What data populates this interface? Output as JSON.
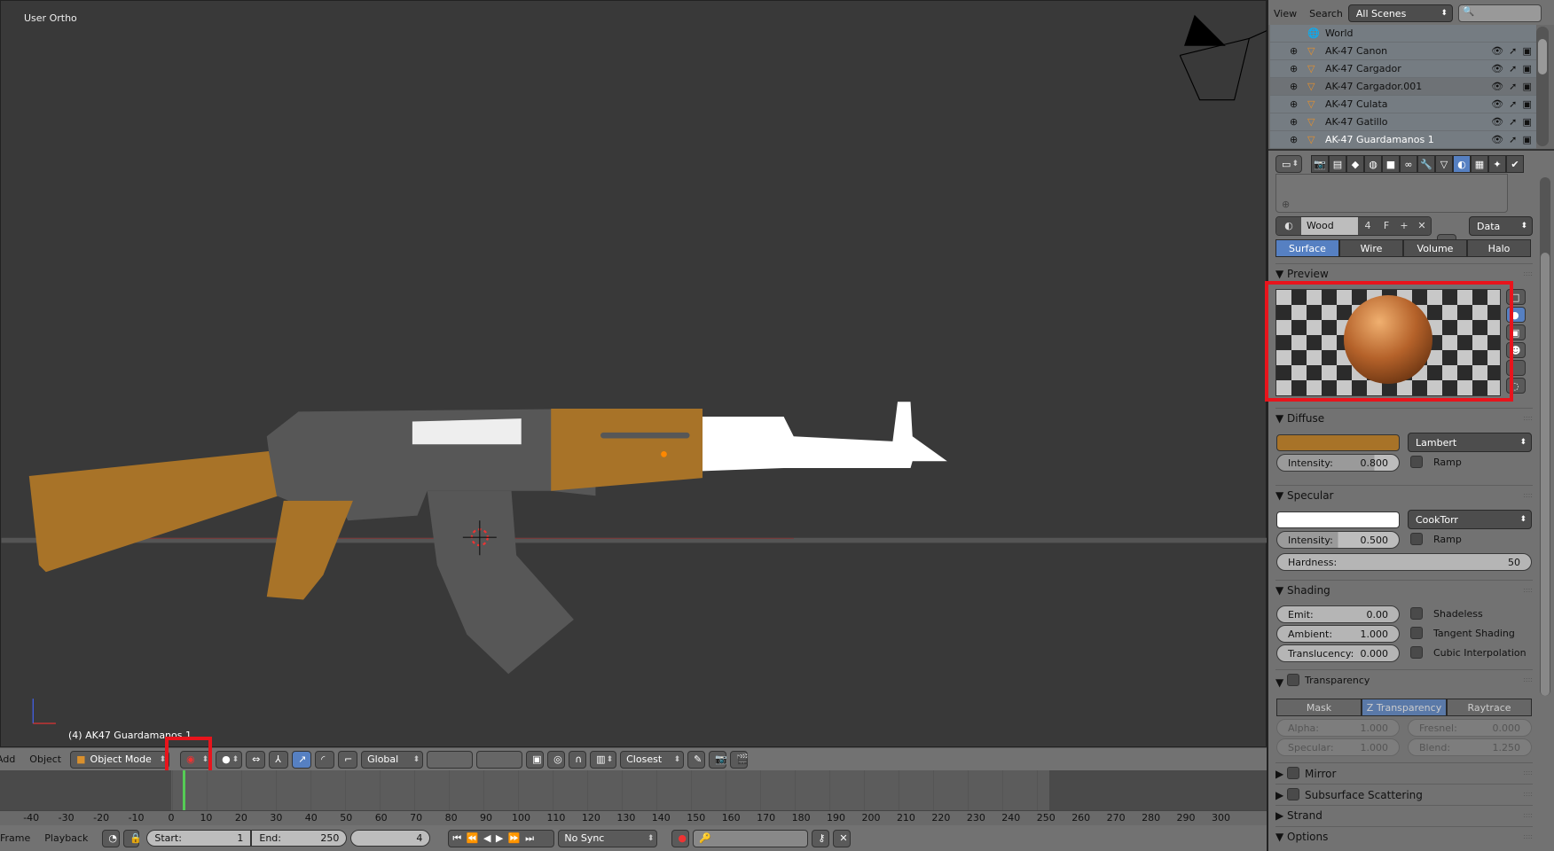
{
  "viewport": {
    "view_label": "User Ortho",
    "object_label": "(4) AK47 Guardamanos 1"
  },
  "header3d": {
    "add": "Add",
    "object": "Object",
    "mode": "Object Mode",
    "orientation": "Global",
    "snap": "Closest"
  },
  "timeline": {
    "ticks": [
      "-40",
      "-30",
      "-20",
      "-10",
      "0",
      "10",
      "20",
      "30",
      "40",
      "50",
      "60",
      "70",
      "80",
      "90",
      "100",
      "110",
      "120",
      "130",
      "140",
      "150",
      "160",
      "170",
      "180",
      "190",
      "200",
      "210",
      "220",
      "230",
      "240",
      "250",
      "260",
      "270",
      "280",
      "290",
      "300"
    ],
    "current_frame": 4
  },
  "bottombar": {
    "frame": "Frame",
    "playback": "Playback",
    "start_label": "Start:",
    "start": "1",
    "end_label": "End:",
    "end": "250",
    "current": "4",
    "sync": "No Sync"
  },
  "outliner": {
    "view": "View",
    "search": "Search",
    "scenes": "All Scenes",
    "world": "World",
    "items": [
      "AK-47  Canon",
      "AK-47 Cargador",
      "AK-47 Cargador.001",
      "AK-47 Culata",
      "AK-47 Gatillo",
      "AK-47 Guardamanos 1"
    ]
  },
  "material": {
    "name": "Wood",
    "users": "4",
    "fake": "F",
    "link": "Data",
    "tabs": [
      "Surface",
      "Wire",
      "Volume",
      "Halo"
    ],
    "preview": "Preview",
    "diffuse": {
      "title": "Diffuse",
      "color": "#a87328",
      "shader": "Lambert",
      "intensity_label": "Intensity:",
      "intensity": "0.800",
      "ramp": "Ramp"
    },
    "specular": {
      "title": "Specular",
      "color": "#ffffff",
      "shader": "CookTorr",
      "intensity_label": "Intensity:",
      "intensity": "0.500",
      "ramp": "Ramp",
      "hardness_label": "Hardness:",
      "hardness": "50"
    },
    "shading": {
      "title": "Shading",
      "emit_label": "Emit:",
      "emit": "0.00",
      "ambient_label": "Ambient:",
      "ambient": "1.000",
      "translucency_label": "Translucency:",
      "translucency": "0.000",
      "shadeless": "Shadeless",
      "tangent": "Tangent Shading",
      "cubic": "Cubic Interpolation"
    },
    "transparency": {
      "title": "Transparency",
      "modes": [
        "Mask",
        "Z Transparency",
        "Raytrace"
      ],
      "alpha_label": "Alpha:",
      "alpha": "1.000",
      "fresnel_label": "Fresnel:",
      "fresnel": "0.000",
      "specular_label": "Specular:",
      "specular": "1.000",
      "blend_label": "Blend:",
      "blend": "1.250"
    },
    "collapsed": [
      "Mirror",
      "Subsurface Scattering",
      "Strand",
      "Options"
    ]
  }
}
